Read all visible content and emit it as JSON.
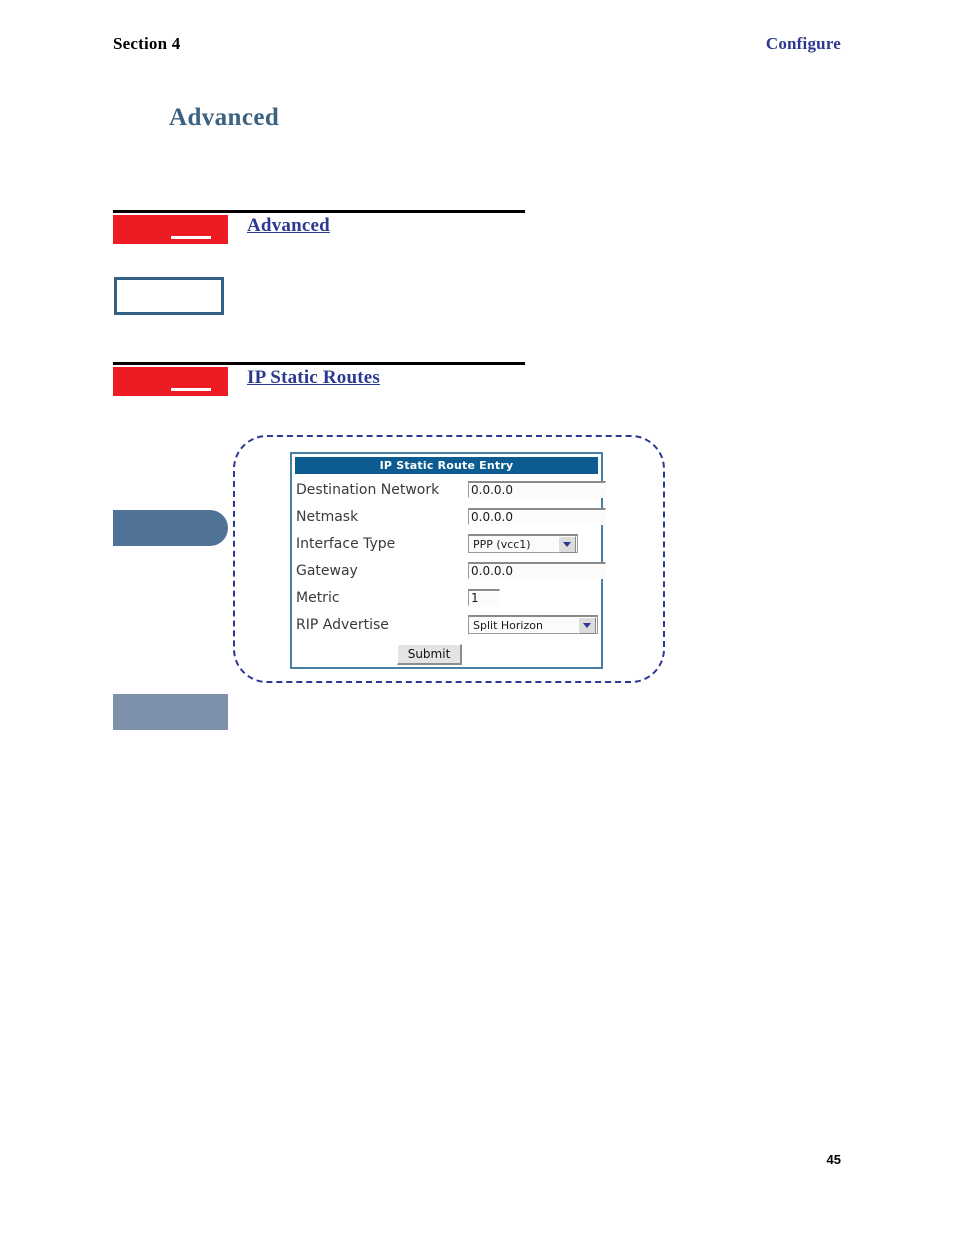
{
  "header": {
    "section_label": "Section 4",
    "chapter_label": "Configure"
  },
  "page_title": "Advanced",
  "sections": [
    {
      "id": "advanced",
      "title": "Advanced",
      "chip_color": "#ed1c24"
    },
    {
      "id": "ip-static-routes",
      "title": "IP Static Routes",
      "chip_color": "#ed1c24"
    }
  ],
  "form": {
    "title": "IP Static Route Entry",
    "titlebar_color": "#0c5c92",
    "border_color": "#4a7fa5",
    "rows": [
      {
        "label": "Destination Network",
        "type": "text",
        "value": "0.0.0.0"
      },
      {
        "label": "Netmask",
        "type": "text",
        "value": "0.0.0.0"
      },
      {
        "label": "Interface Type",
        "type": "select",
        "value": "PPP (vcc1)"
      },
      {
        "label": "Gateway",
        "type": "text",
        "value": "0.0.0.0"
      },
      {
        "label": "Metric",
        "type": "text",
        "value": "1"
      },
      {
        "label": "RIP Advertise",
        "type": "select",
        "value": "Split Horizon"
      }
    ],
    "submit_label": "Submit"
  },
  "callout": {
    "border_color": "#2b3990"
  },
  "margin_blocks": [
    {
      "id": "pill",
      "color": "#4f7296"
    },
    {
      "id": "rect",
      "color": "#7d91ad"
    }
  ],
  "page_number": "45"
}
